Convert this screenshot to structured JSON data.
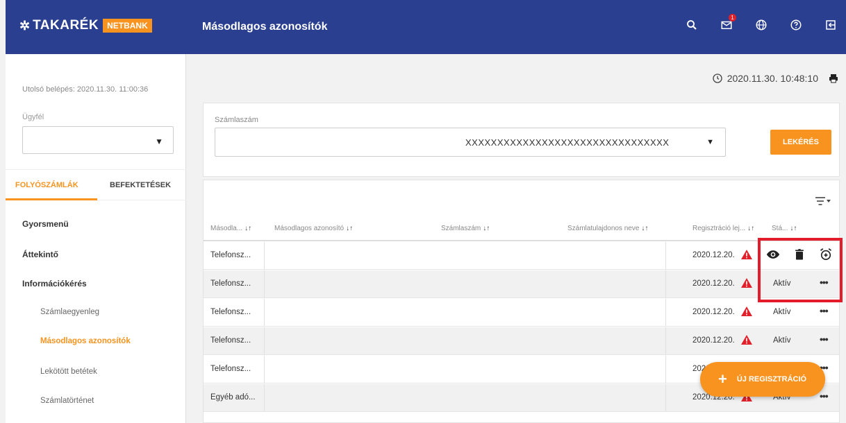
{
  "header": {
    "logo_text": "TAKARÉK",
    "logo_badge": "NETBANK",
    "title": "Másodlagos azonosítók",
    "notification_count": "1",
    "icons": [
      "search-icon",
      "mail-icon",
      "globe-icon",
      "help-icon",
      "logout-icon"
    ]
  },
  "sidebar": {
    "last_login": "Utolsó belépés: 2020.11.30. 11:00:36",
    "client_label": "Ügyfél",
    "client_value": "",
    "tabs": [
      {
        "label": "FOLYÓSZÁMLÁK",
        "active": true
      },
      {
        "label": "BEFEKTETÉSEK",
        "active": false
      }
    ],
    "menu": [
      {
        "label": "Gyorsmenü"
      },
      {
        "label": "Áttekintő"
      },
      {
        "label": "Információkérés"
      }
    ],
    "submenu": [
      {
        "label": "Számlaegyenleg"
      },
      {
        "label": "Másodlagos azonosítók",
        "active": true
      },
      {
        "label": "Lekötött betétek"
      },
      {
        "label": "Számlatörténet"
      }
    ]
  },
  "main": {
    "timestamp": "2020.11.30. 10:48:10",
    "filter": {
      "account_label": "Számlaszám",
      "account_value": "XXXXXXXXXXXXXXXXXXXXXXXXXXXXXXXX",
      "query_button": "LEKÉRÉS"
    },
    "table": {
      "columns": [
        "Másodla...",
        "Másodlagos azonosító",
        "Számlaszám",
        "Számlatulajdonos neve",
        "Regisztráció lej...",
        "Stá..."
      ],
      "rows": [
        {
          "type": "Telefonsz...",
          "expiry": "2020.12.20.",
          "status": "",
          "expanded_actions": true
        },
        {
          "type": "Telefonsz...",
          "expiry": "2020.12.20.",
          "status": "Aktív"
        },
        {
          "type": "Telefonsz...",
          "expiry": "2020.12.20.",
          "status": "Aktív"
        },
        {
          "type": "Telefonsz...",
          "expiry": "2020.12.20.",
          "status": "Aktív"
        },
        {
          "type": "Telefonsz...",
          "expiry": "2020.12.20.",
          "status": ""
        },
        {
          "type": "Egyéb adó...",
          "expiry": "2020.12.20.",
          "status": "Aktív"
        }
      ],
      "more_label": "•••"
    },
    "fab_label": "ÚJ REGISZTRÁCIÓ"
  },
  "colors": {
    "header_bg": "#2a3f8f",
    "accent": "#f7931e",
    "warning": "#e0202a",
    "highlight": "#e41b2a"
  }
}
